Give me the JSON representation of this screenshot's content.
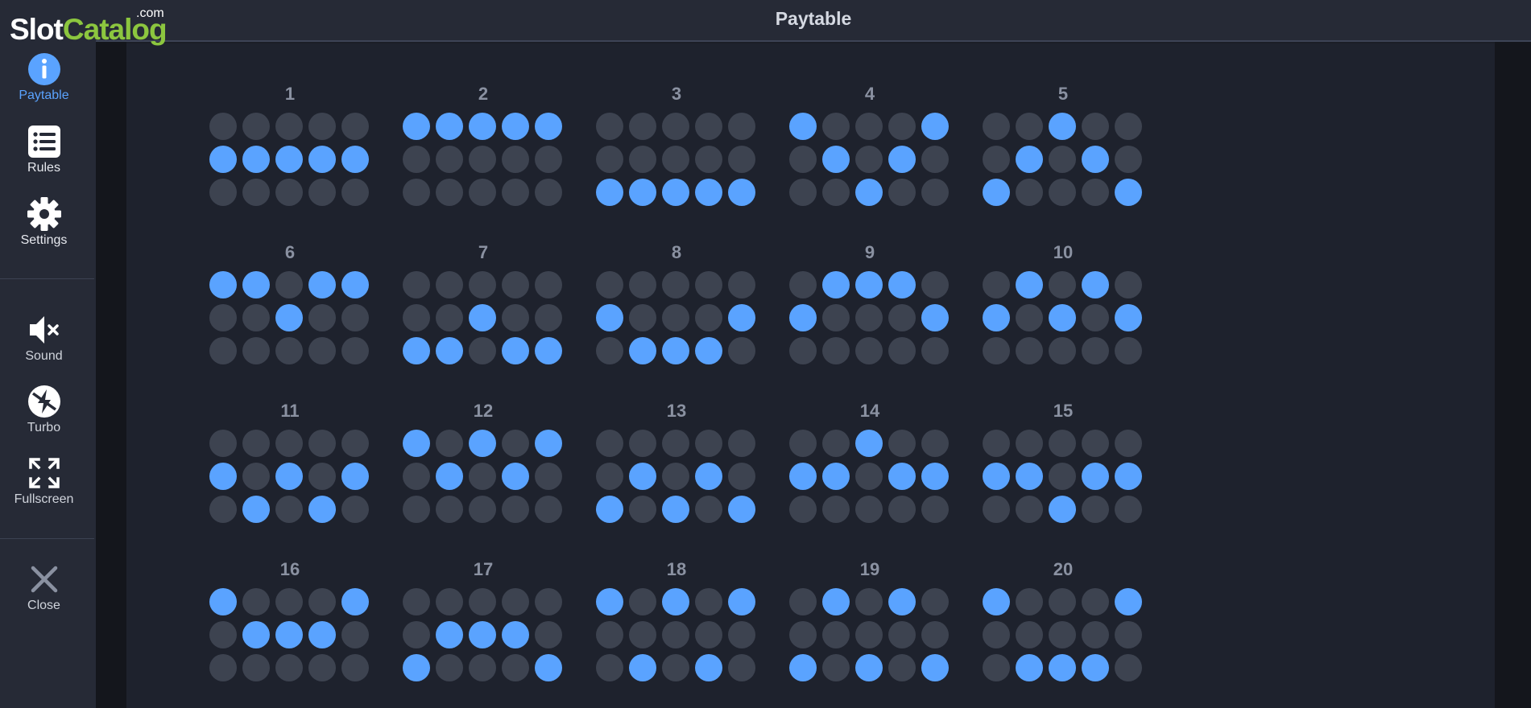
{
  "logo": {
    "com": ".com",
    "slot": "Slot",
    "catalog": "Catalog"
  },
  "header": {
    "title": "Paytable"
  },
  "sidebar": {
    "items": [
      {
        "label": "Paytable",
        "icon": "info-icon",
        "active": true
      },
      {
        "label": "Rules",
        "icon": "list-icon"
      },
      {
        "label": "Settings",
        "icon": "gear-icon"
      },
      {
        "label": "Sound",
        "icon": "speaker-muted-icon"
      },
      {
        "label": "Turbo",
        "icon": "turbo-icon"
      },
      {
        "label": "Fullscreen",
        "icon": "fullscreen-icon"
      },
      {
        "label": "Close",
        "icon": "close-icon"
      }
    ]
  },
  "colors": {
    "accent": "#5aa3ff",
    "inactive_dot": "#3d4350",
    "logo_green": "#8cc63f"
  },
  "paylines": [
    {
      "number": "1",
      "rows": [
        [
          0,
          0,
          0,
          0,
          0
        ],
        [
          1,
          1,
          1,
          1,
          1
        ],
        [
          0,
          0,
          0,
          0,
          0
        ]
      ]
    },
    {
      "number": "2",
      "rows": [
        [
          1,
          1,
          1,
          1,
          1
        ],
        [
          0,
          0,
          0,
          0,
          0
        ],
        [
          0,
          0,
          0,
          0,
          0
        ]
      ]
    },
    {
      "number": "3",
      "rows": [
        [
          0,
          0,
          0,
          0,
          0
        ],
        [
          0,
          0,
          0,
          0,
          0
        ],
        [
          1,
          1,
          1,
          1,
          1
        ]
      ]
    },
    {
      "number": "4",
      "rows": [
        [
          1,
          0,
          0,
          0,
          1
        ],
        [
          0,
          1,
          0,
          1,
          0
        ],
        [
          0,
          0,
          1,
          0,
          0
        ]
      ]
    },
    {
      "number": "5",
      "rows": [
        [
          0,
          0,
          1,
          0,
          0
        ],
        [
          0,
          1,
          0,
          1,
          0
        ],
        [
          1,
          0,
          0,
          0,
          1
        ]
      ]
    },
    {
      "number": "6",
      "rows": [
        [
          1,
          1,
          0,
          1,
          1
        ],
        [
          0,
          0,
          1,
          0,
          0
        ],
        [
          0,
          0,
          0,
          0,
          0
        ]
      ]
    },
    {
      "number": "7",
      "rows": [
        [
          0,
          0,
          0,
          0,
          0
        ],
        [
          0,
          0,
          1,
          0,
          0
        ],
        [
          1,
          1,
          0,
          1,
          1
        ]
      ]
    },
    {
      "number": "8",
      "rows": [
        [
          0,
          0,
          0,
          0,
          0
        ],
        [
          1,
          0,
          0,
          0,
          1
        ],
        [
          0,
          1,
          1,
          1,
          0
        ]
      ]
    },
    {
      "number": "9",
      "rows": [
        [
          0,
          1,
          1,
          1,
          0
        ],
        [
          1,
          0,
          0,
          0,
          1
        ],
        [
          0,
          0,
          0,
          0,
          0
        ]
      ]
    },
    {
      "number": "10",
      "rows": [
        [
          0,
          1,
          0,
          1,
          0
        ],
        [
          1,
          0,
          1,
          0,
          1
        ],
        [
          0,
          0,
          0,
          0,
          0
        ]
      ]
    },
    {
      "number": "11",
      "rows": [
        [
          0,
          0,
          0,
          0,
          0
        ],
        [
          1,
          0,
          1,
          0,
          1
        ],
        [
          0,
          1,
          0,
          1,
          0
        ]
      ]
    },
    {
      "number": "12",
      "rows": [
        [
          1,
          0,
          1,
          0,
          1
        ],
        [
          0,
          1,
          0,
          1,
          0
        ],
        [
          0,
          0,
          0,
          0,
          0
        ]
      ]
    },
    {
      "number": "13",
      "rows": [
        [
          0,
          0,
          0,
          0,
          0
        ],
        [
          0,
          1,
          0,
          1,
          0
        ],
        [
          1,
          0,
          1,
          0,
          1
        ]
      ]
    },
    {
      "number": "14",
      "rows": [
        [
          0,
          0,
          1,
          0,
          0
        ],
        [
          1,
          1,
          0,
          1,
          1
        ],
        [
          0,
          0,
          0,
          0,
          0
        ]
      ]
    },
    {
      "number": "15",
      "rows": [
        [
          0,
          0,
          0,
          0,
          0
        ],
        [
          1,
          1,
          0,
          1,
          1
        ],
        [
          0,
          0,
          1,
          0,
          0
        ]
      ]
    },
    {
      "number": "16",
      "rows": [
        [
          1,
          0,
          0,
          0,
          1
        ],
        [
          0,
          1,
          1,
          1,
          0
        ],
        [
          0,
          0,
          0,
          0,
          0
        ]
      ]
    },
    {
      "number": "17",
      "rows": [
        [
          0,
          0,
          0,
          0,
          0
        ],
        [
          0,
          1,
          1,
          1,
          0
        ],
        [
          1,
          0,
          0,
          0,
          1
        ]
      ]
    },
    {
      "number": "18",
      "rows": [
        [
          1,
          0,
          1,
          0,
          1
        ],
        [
          0,
          0,
          0,
          0,
          0
        ],
        [
          0,
          1,
          0,
          1,
          0
        ]
      ]
    },
    {
      "number": "19",
      "rows": [
        [
          0,
          1,
          0,
          1,
          0
        ],
        [
          0,
          0,
          0,
          0,
          0
        ],
        [
          1,
          0,
          1,
          0,
          1
        ]
      ]
    },
    {
      "number": "20",
      "rows": [
        [
          1,
          0,
          0,
          0,
          1
        ],
        [
          0,
          0,
          0,
          0,
          0
        ],
        [
          0,
          1,
          1,
          1,
          0
        ]
      ]
    }
  ]
}
